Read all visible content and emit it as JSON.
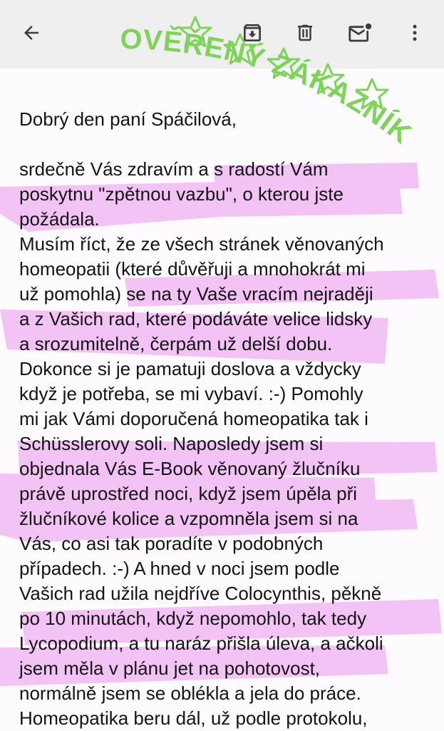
{
  "toolbar": {
    "back_icon": "arrow-back-icon",
    "archive_icon": "archive-icon",
    "delete_icon": "trash-icon",
    "unread_icon": "mail-unread-icon",
    "more_icon": "more-vert-icon"
  },
  "stamp": {
    "text": "OVĚŘENÝ ZÁKAZNÍK",
    "color": "#7fd35a",
    "icon": "star-outline-icon"
  },
  "highlight_color": "#ee9ff2",
  "email": {
    "greeting": "Dobrý den paní Spáčilová,",
    "lines": [
      "srdečně Vás zdravím a s radostí Vám",
      "poskytnu \"zpětnou vazbu\", o kterou jste",
      "požádala.",
      "Musím říct, že ze všech stránek věnovaných",
      "homeopatii (které důvěřuji a mnohokrát mi",
      "už pomohla) se na ty Vaše vracím nejraději",
      "a z Vašich rad, které podáváte velice lidsky",
      "a srozumitelně, čerpám už delší dobu.",
      "Dokonce si je pamatuji doslova a vždycky",
      "když je potřeba, se mi vybaví. :-) Pomohly",
      "mi jak Vámi doporučená homeopatika tak i",
      "Schüsslerovy soli. Naposledy jsem si",
      "objednala Vás E-Book věnovaný žlučníku",
      "právě uprostřed noci, když jsem úpěla při",
      "žlučníkové kolice a vzpomněla jsem si na",
      "Vás, co asi tak poradíte v podobných",
      "případech. :-) A hned v noci jsem podle",
      "Vašich rad užila nejdříve Colocynthis, pěkně",
      "po 10 minutách, když nepomohlo, tak tedy",
      "Lycopodium, a tu naráz přišla úleva, a ačkoli",
      "jsem měla v plánu jet na pohotovost,",
      "normálně jsem se oblékla a jela do práce.",
      "Homeopatika beru dál, už podle protokolu,"
    ]
  }
}
